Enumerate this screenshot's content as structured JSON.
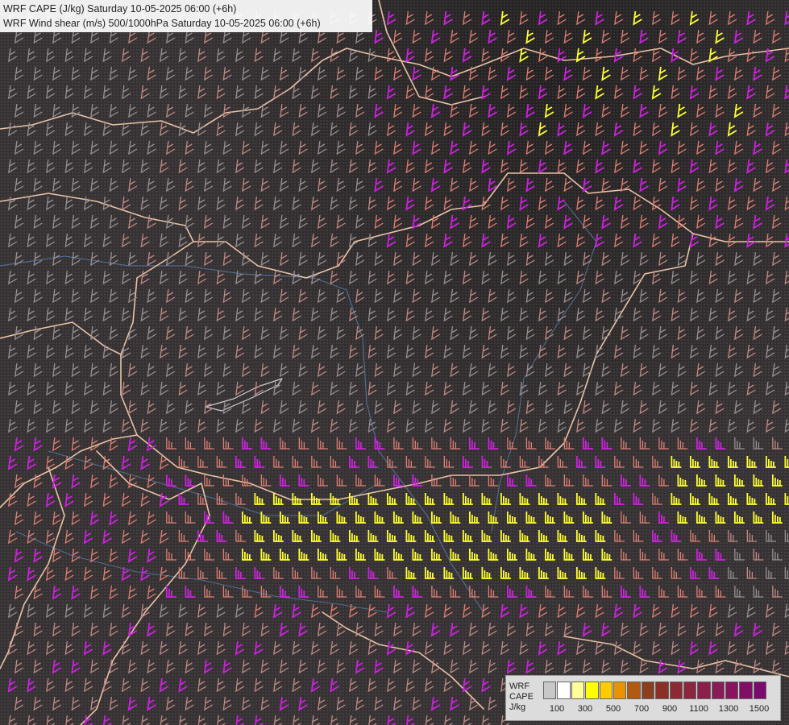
{
  "title": {
    "line1": "WRF CAPE (J/kg) Saturday 10-05-2025 06:00 (+6h)",
    "line2": "WRF Wind shear (m/s) 500/1000hPa Saturday 10-05-2025 06:00 (+6h)"
  },
  "legend": {
    "label_lines": [
      "WRF",
      "CAPE",
      "J/kg"
    ],
    "ticks": [
      "100",
      "300",
      "500",
      "700",
      "900",
      "1100",
      "1300",
      "1500"
    ],
    "colors": [
      "#c8c8c8",
      "#ffffff",
      "#ffff99",
      "#ffff00",
      "#ffcc00",
      "#e89400",
      "#b05a12",
      "#8a4020",
      "#8a3028",
      "#8c2a34",
      "#8c2640",
      "#8a204a",
      "#881c54",
      "#86145e",
      "#800f66",
      "#7a0a6e"
    ]
  },
  "map": {
    "layers": [
      "wind-shear-barbs",
      "cape-shading",
      "country-borders",
      "rivers"
    ],
    "barb_colors": {
      "low": "#9a8f91",
      "mid": "#c08a85",
      "high": "#e07f74",
      "strong": "#cc22dd",
      "extreme": "#ffff33"
    }
  }
}
